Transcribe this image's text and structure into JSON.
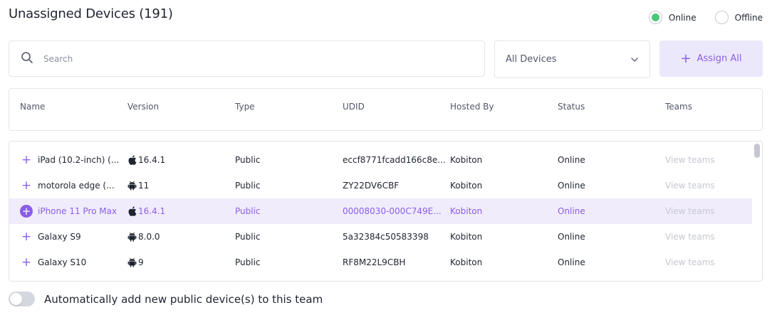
{
  "header": {
    "title": "Unassigned Devices (191)"
  },
  "status_filter": {
    "options": [
      {
        "label": "Online",
        "selected": true
      },
      {
        "label": "Offline",
        "selected": false
      }
    ],
    "online_color": "#4cc77a"
  },
  "search": {
    "placeholder": "Search",
    "value": "",
    "icon": "search-icon"
  },
  "device_filter": {
    "selected": "All Devices",
    "icon": "chevron-down-icon"
  },
  "assign_all": {
    "label": "Assign All",
    "icon": "plus-icon",
    "color": "#8a5ee6",
    "background": "#ece8fb"
  },
  "table": {
    "columns": [
      "Name",
      "Version",
      "Type",
      "UDID",
      "Hosted By",
      "Status",
      "Teams"
    ],
    "rows": [
      {
        "name": "iPad (10.2-inch) (...",
        "os": "apple",
        "version": "16.4.1",
        "type": "Public",
        "udid": "eccf8771fcadd166c8e...",
        "hosted_by": "Kobiton",
        "status": "Online",
        "teams": "View teams",
        "highlighted": false
      },
      {
        "name": "motorola edge (...",
        "os": "android",
        "version": "11",
        "type": "Public",
        "udid": "ZY22DV6CBF",
        "hosted_by": "Kobiton",
        "status": "Online",
        "teams": "View teams",
        "highlighted": false
      },
      {
        "name": "iPhone 11 Pro Max",
        "os": "apple",
        "version": "16.4.1",
        "type": "Public",
        "udid": "00008030-000C749E...",
        "hosted_by": "Kobiton",
        "status": "Online",
        "teams": "View teams",
        "highlighted": true
      },
      {
        "name": "Galaxy S9",
        "os": "android",
        "version": "8.0.0",
        "type": "Public",
        "udid": "5a32384c50583398",
        "hosted_by": "Kobiton",
        "status": "Online",
        "teams": "View teams",
        "highlighted": false
      },
      {
        "name": "Galaxy S10",
        "os": "android",
        "version": "9",
        "type": "Public",
        "udid": "RF8M22L9CBH",
        "hosted_by": "Kobiton",
        "status": "Online",
        "teams": "View teams",
        "highlighted": false
      }
    ],
    "highlight_color": "#f1ecfc"
  },
  "auto_add": {
    "label": "Automatically add new public device(s) to this team",
    "enabled": false
  }
}
